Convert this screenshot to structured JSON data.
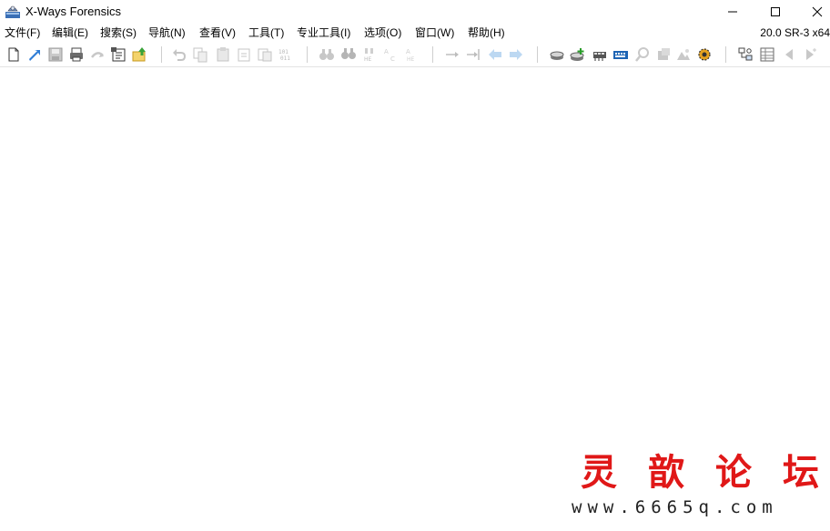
{
  "window": {
    "title": "X-Ways Forensics"
  },
  "menu": {
    "items": [
      "文件(F)",
      "编辑(E)",
      "搜索(S)",
      "导航(N)",
      "查看(V)",
      "工具(T)",
      "专业工具(I)",
      "选项(O)",
      "窗口(W)",
      "帮助(H)"
    ],
    "version": "20.0 SR-3 x64"
  },
  "toolbar": {
    "icons": [
      "new-file-icon",
      "open-icon",
      "save-icon",
      "print-icon",
      "undo-arrow-icon",
      "properties-icon",
      "export-icon",
      "undo-icon",
      "copy-icon",
      "paste-icon",
      "cut-icon",
      "clipboard-icon",
      "binary-icon",
      "find-icon",
      "find-hex-icon",
      "find-text-icon",
      "replace-icon",
      "find-ab-icon",
      "goto-icon",
      "jump-icon",
      "back-icon",
      "forward-icon",
      "open-disk-icon",
      "add-disk-icon",
      "ram-icon",
      "calculator-icon",
      "zoom-icon",
      "hash-icon",
      "image-icon",
      "settings-gear-icon",
      "case-tree-icon",
      "table-icon",
      "prev-icon",
      "next-icon"
    ]
  },
  "watermark": {
    "chars": "灵歆论坛",
    "url": "www.6665q.com",
    "color": "#e01818"
  }
}
